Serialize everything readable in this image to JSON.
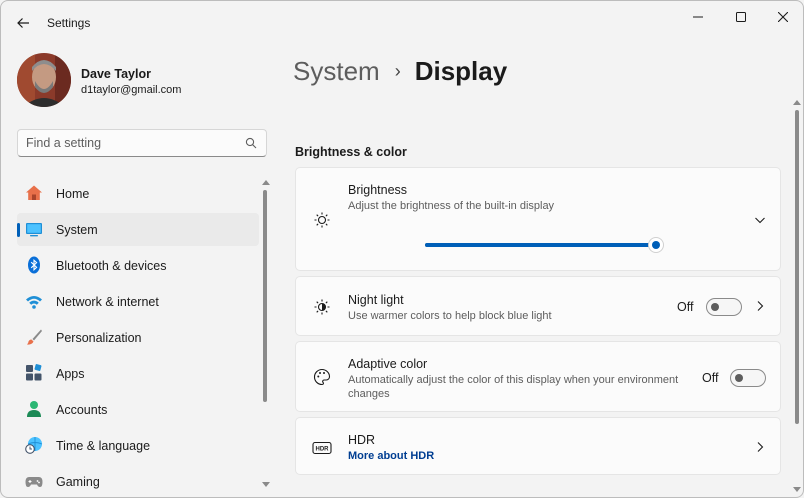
{
  "window": {
    "title": "Settings"
  },
  "user": {
    "name": "Dave Taylor",
    "email": "d1taylor@gmail.com"
  },
  "search": {
    "placeholder": "Find a setting"
  },
  "nav": [
    {
      "label": "Home",
      "icon": "home-icon",
      "selected": false
    },
    {
      "label": "System",
      "icon": "system-icon",
      "selected": true
    },
    {
      "label": "Bluetooth & devices",
      "icon": "bluetooth-icon",
      "selected": false
    },
    {
      "label": "Network & internet",
      "icon": "wifi-icon",
      "selected": false
    },
    {
      "label": "Personalization",
      "icon": "brush-icon",
      "selected": false
    },
    {
      "label": "Apps",
      "icon": "apps-icon",
      "selected": false
    },
    {
      "label": "Accounts",
      "icon": "accounts-icon",
      "selected": false
    },
    {
      "label": "Time & language",
      "icon": "clock-globe-icon",
      "selected": false
    },
    {
      "label": "Gaming",
      "icon": "gamepad-icon",
      "selected": false
    }
  ],
  "breadcrumb": {
    "parent": "System",
    "current": "Display"
  },
  "section": {
    "title": "Brightness & color"
  },
  "brightness": {
    "title": "Brightness",
    "description": "Adjust the brightness of the built-in display",
    "level": 0.98
  },
  "night_light": {
    "title": "Night light",
    "description": "Use warmer colors to help block blue light",
    "state": "Off"
  },
  "adaptive_color": {
    "title": "Adaptive color",
    "description_line1": "Automatically adjust the color of this display when your environment",
    "description_line2": "changes",
    "state": "Off"
  },
  "hdr": {
    "title": "HDR",
    "link": "More about HDR",
    "icon_text": "HDR"
  },
  "colors": {
    "accent": "#005fb8",
    "background": "#f3f3f3",
    "card": "#fbfbfb"
  }
}
